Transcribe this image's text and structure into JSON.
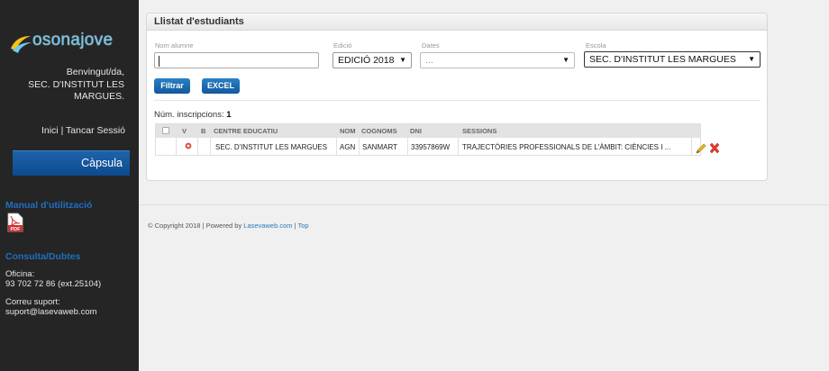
{
  "sidebar": {
    "logo_text": "osonajove",
    "welcome_line1": "Benvingut/da,",
    "welcome_line2": "SEC. D'INSTITUT LES",
    "welcome_line3": "MARGUES.",
    "home_link": "Inici",
    "separator": "|",
    "logout_link": "Tancar Sessió",
    "capsula_label": "Càpsula",
    "manual_title": "Manual d'utilització",
    "pdf_label": "PDF",
    "consulta_title": "Consulta/Dubtes",
    "office_label": "Oficina:",
    "office_phone": "93 702 72 86 (ext.25104)",
    "support_label": "Correu suport:",
    "support_email": "suport@lasevaweb.com"
  },
  "panel": {
    "title": "Llistat d'estudiants",
    "filters": {
      "name_label": "Nom alumne",
      "name_value": "",
      "edition_label": "Edició",
      "edition_value": "EDICIÓ 2018",
      "dates_label": "Dates",
      "dates_value": "...",
      "school_label": "Escola",
      "school_value": "SEC. D'INSTITUT LES MARGUES"
    },
    "filter_button": "Filtrar",
    "excel_button": "EXCEL",
    "count_label": "Núm. inscripcions:",
    "count_value": "1",
    "table": {
      "headers": {
        "v": "V",
        "b": "B",
        "centre": "CENTRE EDUCATIU",
        "nom": "NOM",
        "cognoms": "COGNOMS",
        "dni": "DNI",
        "sessions": "SESSIONS"
      },
      "rows": [
        {
          "centre": "SEC. D'INSTITUT LES MARGUES",
          "nom": "AGN",
          "cognoms": "SANMART",
          "dni": "33957869W",
          "sessions": "TRAJECTÒRIES PROFESSIONALS DE L'ÀMBIT: CIÈNCIES I ..."
        }
      ]
    }
  },
  "footer": {
    "copyright": "© Copyright 2018 | Powered by",
    "powered_link": "Lasevaweb.com",
    "sep": "|",
    "top_link": "Top"
  },
  "colors": {
    "sidebar_bg": "#252525",
    "accent_blue": "#1f6fc2",
    "button_blue": "#12599c",
    "status_red": "#e0483e"
  }
}
